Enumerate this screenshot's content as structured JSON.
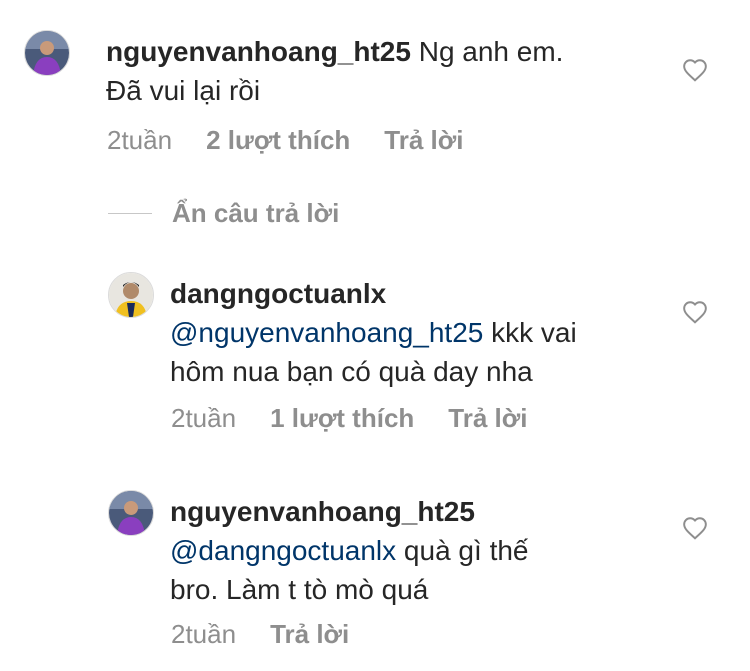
{
  "comments": [
    {
      "username": "nguyenvanhoang_ht25",
      "text": " Ng anh em.",
      "text_line2": "Đã vui lại rồi",
      "time": "2tuần",
      "likes": "2 lượt thích",
      "reply": "Trả lời"
    },
    {
      "username": "dangngoctuanlx",
      "mention": "@nguyenvanhoang_ht25",
      "text": " kkk vai",
      "text_line2": "hôm nua bạn có quà day nha",
      "time": "2tuần",
      "likes": "1 lượt thích",
      "reply": "Trả lời"
    },
    {
      "username": "nguyenvanhoang_ht25",
      "mention": "@dangngoctuanlx",
      "text": " quà gì thế",
      "text_line2": "bro. Làm t tò mò quá",
      "time": "2tuần",
      "reply": "Trả lời"
    }
  ],
  "hide_replies": "Ẩn câu trả lời",
  "icons": {
    "like": "heart-icon"
  },
  "colors": {
    "mention": "#003569",
    "meta": "#8e8e8e",
    "text": "#262626"
  }
}
